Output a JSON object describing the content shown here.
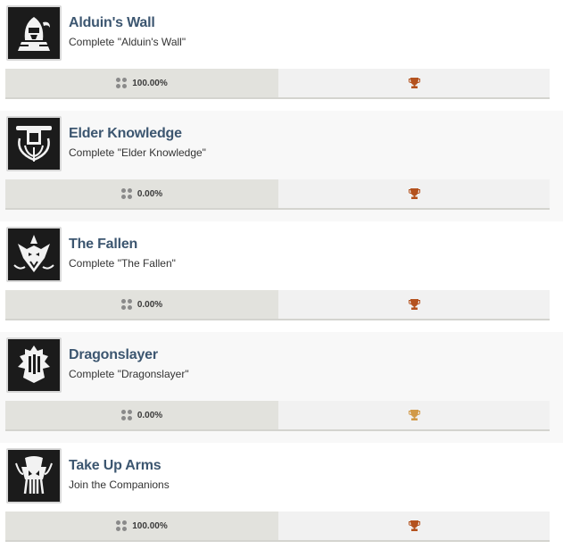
{
  "colors": {
    "title": "#3c5670",
    "trophy_dark": "#b4521e",
    "trophy_light": "#d19a48",
    "bar_left": "#e2e2dd",
    "bar_right": "#f1f1f1"
  },
  "achievements": [
    {
      "title": "Alduin's Wall",
      "description": "Complete \"Alduin's Wall\"",
      "percent": "100.00%",
      "icon": "knight-helmet-icon",
      "trophy": "trophy-icon"
    },
    {
      "title": "Elder Knowledge",
      "description": "Complete \"Elder Knowledge\"",
      "percent": "0.00%",
      "icon": "elder-scroll-icon",
      "trophy": "trophy-icon"
    },
    {
      "title": "The Fallen",
      "description": "Complete \"The Fallen\"",
      "percent": "0.00%",
      "icon": "dragon-head-icon",
      "trophy": "trophy-icon"
    },
    {
      "title": "Dragonslayer",
      "description": "Complete \"Dragonslayer\"",
      "percent": "0.00%",
      "icon": "dragon-crest-icon",
      "trophy": "trophy-icon"
    },
    {
      "title": "Take Up Arms",
      "description": "Join the Companions",
      "percent": "100.00%",
      "icon": "companions-crest-icon",
      "trophy": "trophy-icon"
    }
  ]
}
